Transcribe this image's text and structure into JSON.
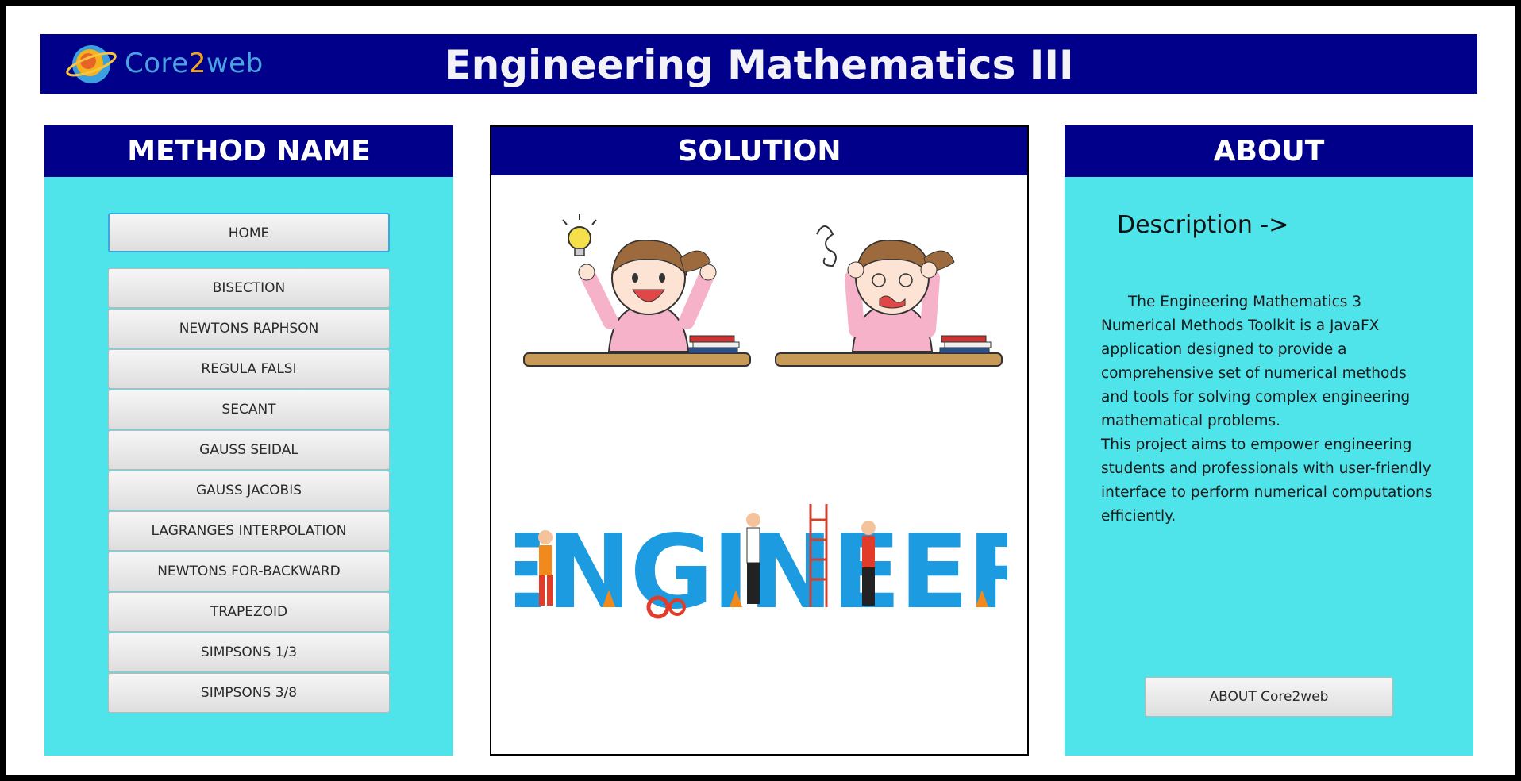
{
  "header": {
    "logo_text_a": "Core",
    "logo_text_b": "2",
    "logo_text_c": "web",
    "title": "Engineering Mathematics III"
  },
  "method_panel": {
    "heading": "METHOD NAME",
    "home_label": "HOME",
    "methods": [
      "BISECTION",
      "NEWTONS RAPHSON",
      "REGULA FALSI",
      "SECANT",
      "GAUSS SEIDAL",
      "GAUSS JACOBIS",
      "LAGRANGES INTERPOLATION",
      "NEWTONS FOR-BACKWARD",
      "TRAPEZOID",
      "SIMPSONS 1/3",
      "SIMPSONS 3/8"
    ]
  },
  "solution_panel": {
    "heading": "SOLUTION",
    "image_word": "ENGINEER"
  },
  "about_panel": {
    "heading": "ABOUT",
    "description_title": "Description ->",
    "paragraph1": "The Engineering Mathematics 3 Numerical Methods Toolkit is a JavaFX application designed to provide a comprehensive set of numerical methods  and  tools for solving  complex engineering mathematical problems.",
    "paragraph2": "This project aims to empower engineering students and professionals with user-friendly interface to perform numerical computations efficiently.",
    "about_button": "ABOUT Core2web"
  },
  "colors": {
    "header_bg": "#00008b",
    "panel_bg": "#4fe3ea",
    "button_bg": "#e6e6e6",
    "focus_border": "#3aa7e0"
  }
}
